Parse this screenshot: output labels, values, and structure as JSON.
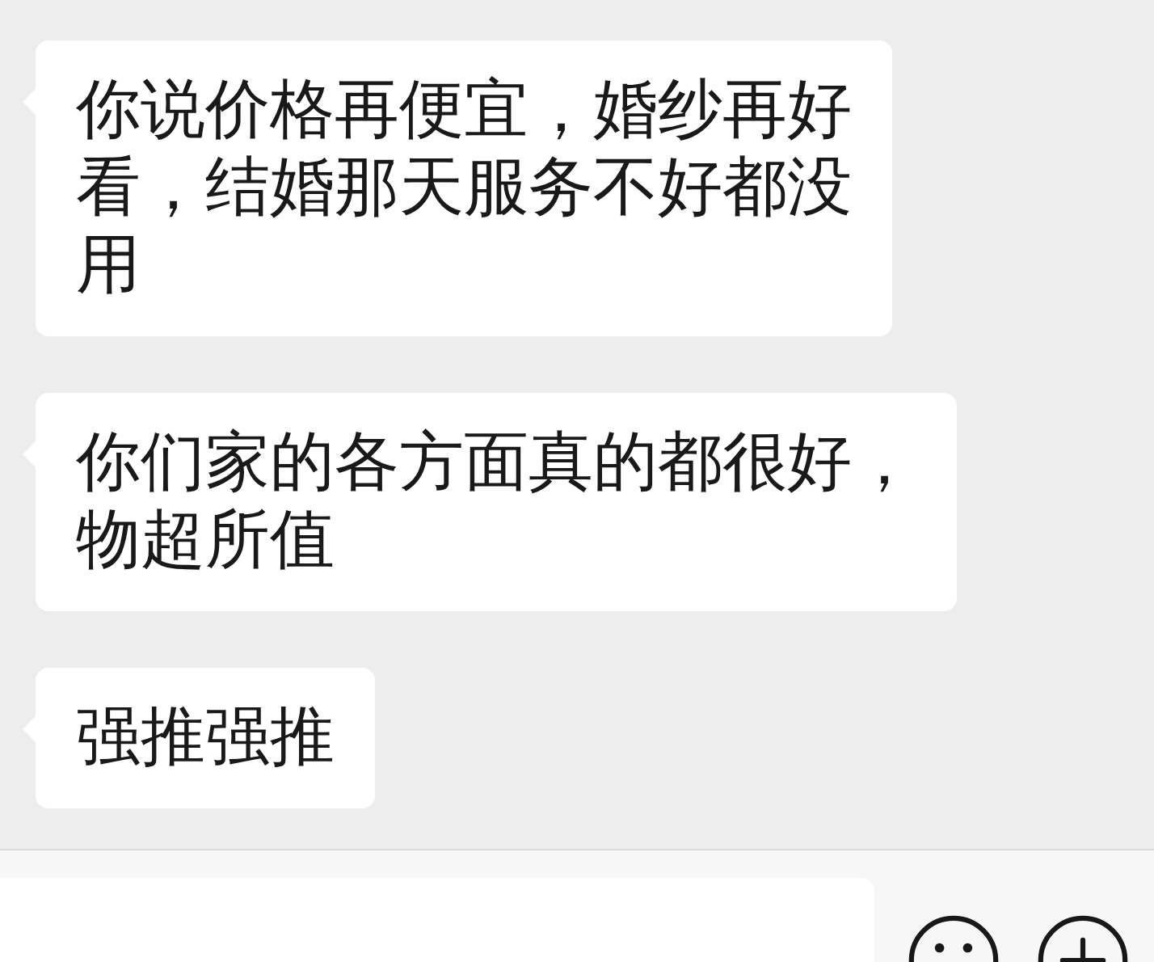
{
  "messages": [
    {
      "lines": [
        "你说价格再便宜，婚纱再好",
        "看，结婚那天服务不好都没",
        "用"
      ]
    },
    {
      "lines": [
        "你们家的各方面真的都很好，",
        "物超所值"
      ]
    },
    {
      "lines": [
        "强推强推"
      ]
    }
  ]
}
